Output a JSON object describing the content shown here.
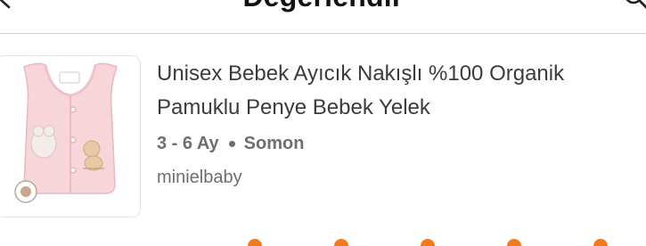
{
  "header": {
    "title": "Değerlendir",
    "back_icon": "chevron-left-icon",
    "search_icon": "search-icon"
  },
  "product": {
    "title": "Unisex Bebek Ayıcık Nakışlı %100 Organik Pamuklu Penye Bebek Yelek",
    "size": "3 - 6 Ay",
    "color": "Somon",
    "brand": "minielbaby",
    "image_icon": "baby-vest-image"
  },
  "rating": {
    "star_icon": "star-icon",
    "star_color": "#f27a1a"
  }
}
